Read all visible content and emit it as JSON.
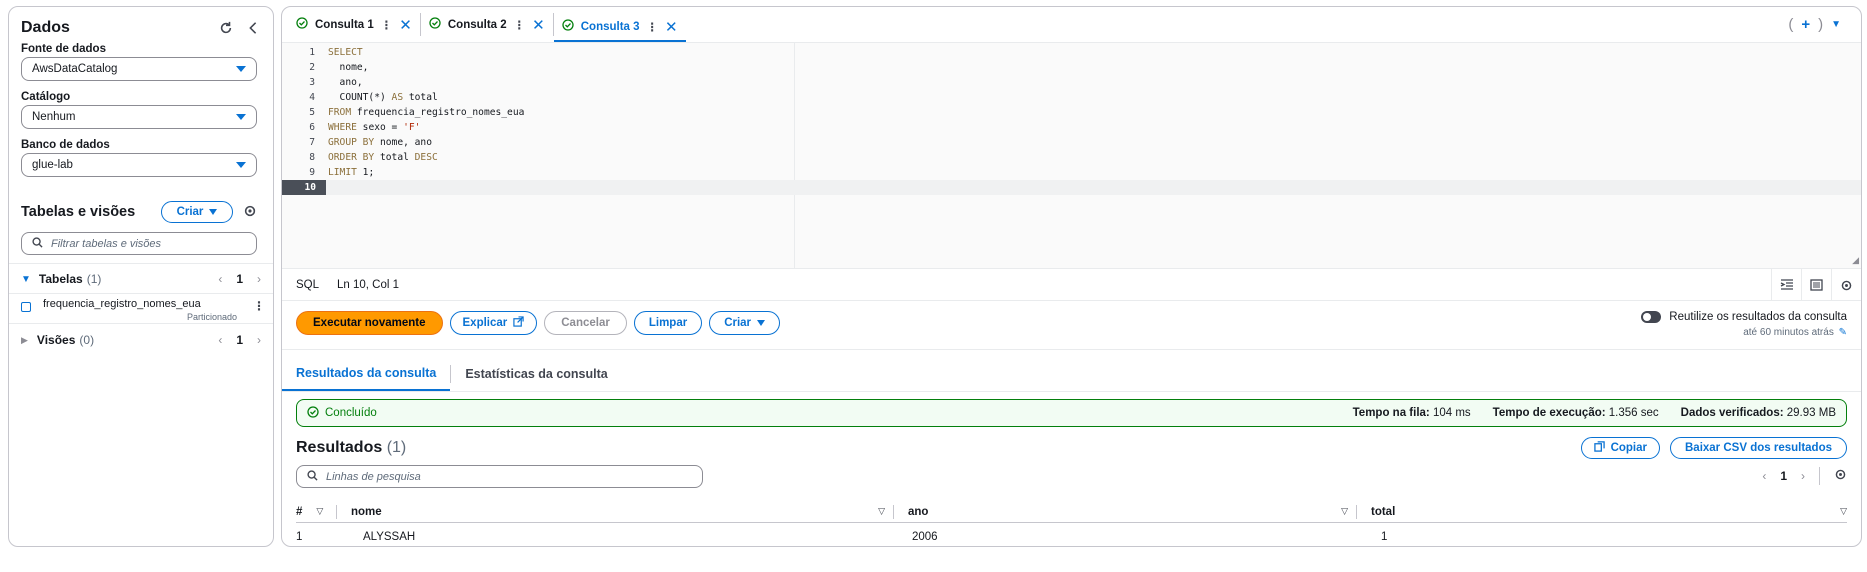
{
  "sidebar": {
    "title": "Dados",
    "data_source_label": "Fonte de dados",
    "data_source_value": "AwsDataCatalog",
    "catalog_label": "Catálogo",
    "catalog_value": "Nenhum",
    "database_label": "Banco de dados",
    "database_value": "glue-lab",
    "tables_views_title": "Tabelas e visões",
    "create_label": "Criar",
    "filter_placeholder": "Filtrar tabelas e visões",
    "tables_label": "Tabelas",
    "tables_count": "(1)",
    "tables_page": "1",
    "table_name": "frequencia_registro_nomes_eua",
    "table_tag": "Particionado",
    "views_label": "Visões",
    "views_count": "(0)",
    "views_page": "1"
  },
  "tabs": [
    {
      "label": "Consulta 1"
    },
    {
      "label": "Consulta 2"
    },
    {
      "label": "Consulta 3"
    }
  ],
  "editor": {
    "lines": [
      {
        "n": "1"
      },
      {
        "n": "2"
      },
      {
        "n": "3"
      },
      {
        "n": "4"
      },
      {
        "n": "5"
      },
      {
        "n": "6"
      },
      {
        "n": "7"
      },
      {
        "n": "8"
      },
      {
        "n": "9"
      },
      {
        "n": "10"
      }
    ],
    "code": {
      "l1_kw": "SELECT",
      "l2": "  nome,",
      "l3": "  ano,",
      "l4_a": "  COUNT(*) ",
      "l4_kw": "AS",
      "l4_b": " total",
      "l5_kw": "FROM",
      "l5_b": " frequencia_registro_nomes_eua",
      "l6_kw": "WHERE",
      "l6_b": " sexo = ",
      "l6_str": "'F'",
      "l7_kw": "GROUP BY",
      "l7_b": " nome, ano",
      "l8_kw": "ORDER BY",
      "l8_b": " total ",
      "l8_kw2": "DESC",
      "l9_kw": "LIMIT",
      "l9_b": " 1;"
    },
    "language": "SQL",
    "cursor": "Ln 10, Col 1"
  },
  "actions": {
    "run_again": "Executar novamente",
    "explain": "Explicar",
    "cancel": "Cancelar",
    "clear": "Limpar",
    "create": "Criar",
    "reuse_label": "Reutilize os resultados da consulta",
    "reuse_sub": "até 60 minutos atrás"
  },
  "results_tabs": {
    "results": "Resultados da consulta",
    "stats": "Estatísticas da consulta"
  },
  "status": {
    "state": "Concluído",
    "queue_label": "Tempo na fila:",
    "queue_value": "104 ms",
    "exec_label": "Tempo de execução:",
    "exec_value": "1.356 sec",
    "scanned_label": "Dados verificados:",
    "scanned_value": "29.93 MB"
  },
  "results": {
    "title": "Resultados",
    "count": "(1)",
    "copy": "Copiar",
    "download": "Baixar CSV dos resultados",
    "search_placeholder": "Linhas de pesquisa",
    "page": "1",
    "columns": [
      "#",
      "nome",
      "ano",
      "total"
    ],
    "rows": [
      [
        "1",
        "ALYSSAH",
        "2006",
        "1"
      ]
    ]
  },
  "colors": {
    "accent": "#0972d3",
    "primary_button": "#ff9900",
    "success": "#037f0c"
  }
}
